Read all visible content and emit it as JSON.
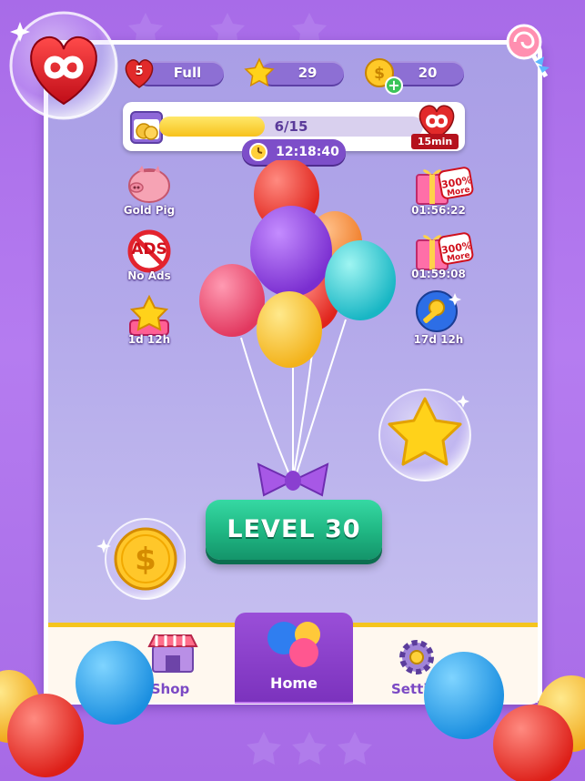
{
  "status_bar": {
    "lives_count": "5",
    "lives_status": "Full",
    "stars": "29",
    "coins": "20"
  },
  "progress": {
    "text": "6/15",
    "fraction": 0.4,
    "reward_time": "15min",
    "timer": "12:18:40"
  },
  "left_offers": [
    {
      "label": "Gold Pig",
      "icon": "piggy-bank-icon"
    },
    {
      "label": "No Ads",
      "icon": "no-ads-icon",
      "badge": "ADS"
    },
    {
      "label": "1d 12h",
      "icon": "star-event-icon"
    }
  ],
  "right_offers": [
    {
      "label": "01:56:22",
      "icon": "gift-box-icon",
      "badge_line1": "300%",
      "badge_line2": "More"
    },
    {
      "label": "01:59:08",
      "icon": "gift-box-icon",
      "badge_line1": "300%",
      "badge_line2": "More"
    },
    {
      "label": "17d 12h",
      "icon": "key-orb-icon"
    }
  ],
  "level_button": {
    "label": "LEVEL 30"
  },
  "bottom_nav": {
    "shop": "Shop",
    "home": "Home",
    "settings": "Setti"
  },
  "colors": {
    "background": "#a86be8",
    "level_button": "#1fb582",
    "progress_fill": "#f7c21c",
    "heart": "#e0202b"
  }
}
